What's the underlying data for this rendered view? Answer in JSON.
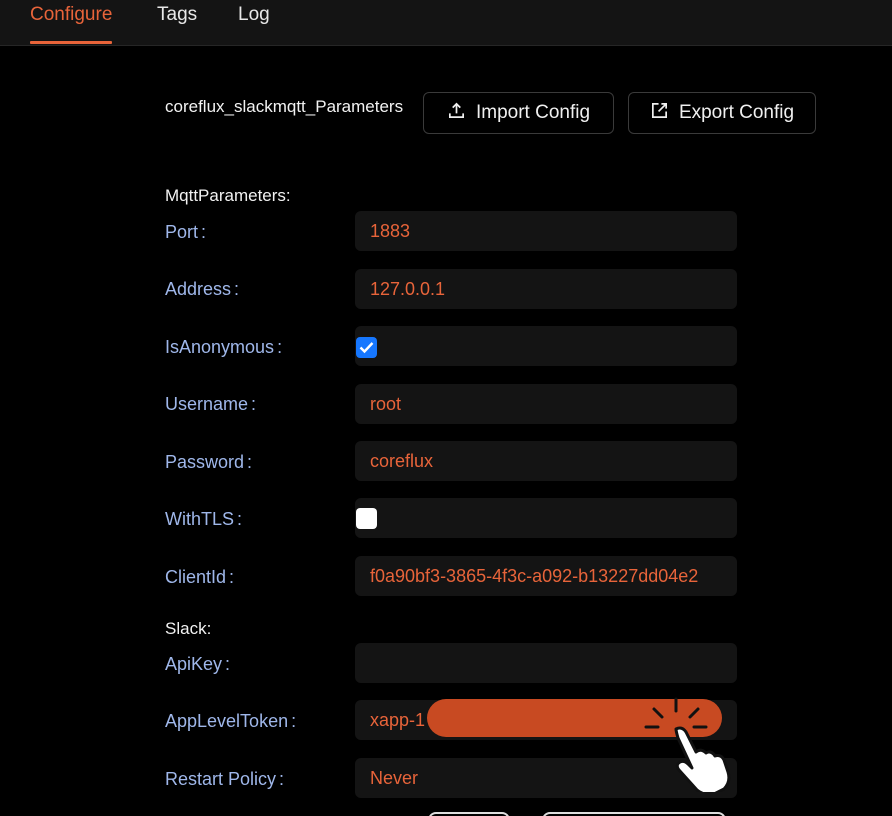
{
  "tabs": [
    {
      "label": "Configure",
      "active": true
    },
    {
      "label": "Tags",
      "active": false
    },
    {
      "label": "Log",
      "active": false
    }
  ],
  "header": {
    "title": "coreflux_slackmqtt_Parameters",
    "import_label": "Import Config",
    "export_label": "Export Config"
  },
  "groups": {
    "mqtt": "MqttParameters:",
    "slack": "Slack:"
  },
  "fields": {
    "port": {
      "label": "Port",
      "value": "1883"
    },
    "address": {
      "label": "Address",
      "value": "127.0.0.1"
    },
    "is_anonymous": {
      "label": "IsAnonymous",
      "checked": true
    },
    "username": {
      "label": "Username",
      "value": "root"
    },
    "password": {
      "label": "Password",
      "value": "coreflux"
    },
    "with_tls": {
      "label": "WithTLS",
      "checked": false
    },
    "client_id": {
      "label": "ClientId",
      "value": "f0a90bf3-3865-4f3c-a092-b13227dd04e2"
    },
    "api_key": {
      "label": "ApiKey",
      "value": ""
    },
    "app_level_token": {
      "label": "AppLevelToken",
      "value": "xapp-1"
    },
    "restart_policy": {
      "label": "Restart Policy",
      "value": "Never"
    }
  },
  "colors": {
    "accent": "#e8643a",
    "label": "#9fb7ea",
    "field_bg": "#141414",
    "checkbox_on": "#1677ff",
    "redaction": "#c84a22"
  },
  "icons": {
    "import": "upload-icon",
    "export": "external-link-icon",
    "cursor": "hand-pointer-icon"
  }
}
